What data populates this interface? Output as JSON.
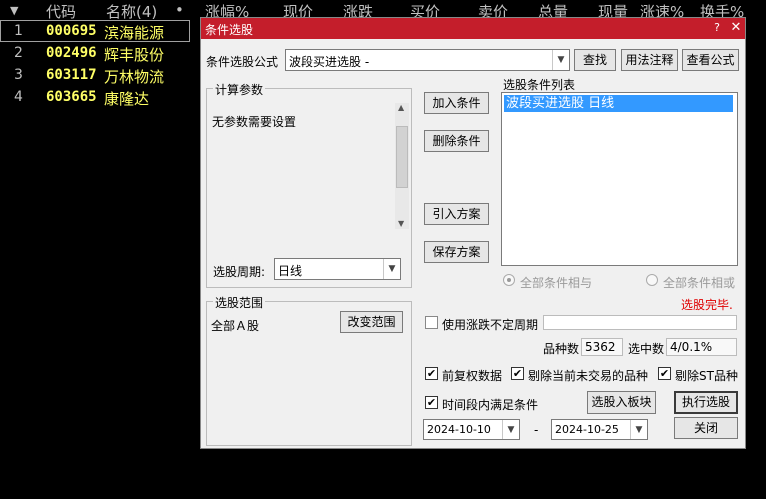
{
  "stock_list": {
    "columns": [
      "代码",
      "名称(4)",
      "•",
      "涨幅%",
      "现价",
      "涨跌",
      "买价",
      "卖价",
      "总量",
      "现量",
      "涨速%",
      "换手%"
    ],
    "rows": [
      {
        "num": "1",
        "code": "000695",
        "name": "滨海能源"
      },
      {
        "num": "2",
        "code": "002496",
        "name": "辉丰股份"
      },
      {
        "num": "3",
        "code": "603117",
        "name": "万林物流"
      },
      {
        "num": "4",
        "code": "603665",
        "name": "康隆达"
      }
    ]
  },
  "dialog": {
    "title": "条件选股",
    "formula_label": "条件选股公式",
    "formula_value": "波段买进选股 -",
    "find_btn": "查找",
    "usage_btn": "用法注释",
    "view_formula_btn": "查看公式",
    "params_group": "计算参数",
    "params_text": "无参数需要设置",
    "period_label": "选股周期:",
    "period_value": "日线",
    "add_btn": "加入条件",
    "delete_btn": "删除条件",
    "import_btn": "引入方案",
    "save_btn": "保存方案",
    "condition_list_label": "选股条件列表",
    "condition_items": [
      "波段买进选股  日线"
    ],
    "radio_and": "全部条件相与",
    "radio_or": "全部条件相或",
    "status": "选股完毕.",
    "range_group": "选股范围",
    "range_value": "全部Ａ股",
    "change_range_btn": "改变范围",
    "variable_period_label": "使用涨跌不定周期",
    "count_label": "品种数",
    "count_value": "5362",
    "selected_label": "选中数",
    "selected_value": "4/0.1%",
    "chk_fq_label": "前复权数据",
    "chk_exclude_label": "剔除当前未交易的品种",
    "chk_st_label": "剔除ST品种",
    "chk_period_label": "时间段内满足条件",
    "to_block_btn": "选股入板块",
    "run_btn": "执行选股",
    "date_from": "2024-10-10",
    "date_sep": "-",
    "date_to": "2024-10-25",
    "close_btn": "关闭",
    "check_mark": "✔"
  },
  "colors": {
    "title_bar": "#c41e2b",
    "status_text": "#e00000",
    "selection": "#3399ff",
    "code_text": "#ffff66"
  }
}
